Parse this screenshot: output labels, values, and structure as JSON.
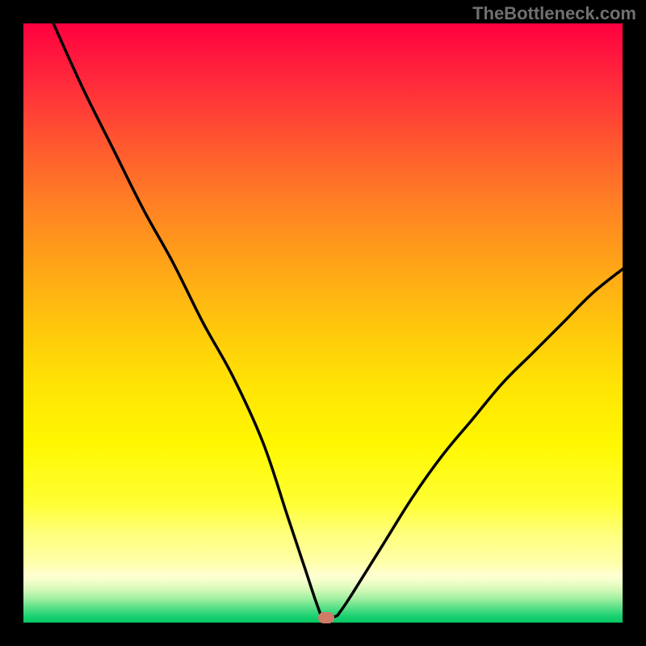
{
  "attribution": "TheBottleneck.com",
  "colors": {
    "page_bg": "#000000",
    "attribution_text": "#707070",
    "curve": "#000000",
    "marker": "#cf7b68"
  },
  "chart_data": {
    "type": "line",
    "title": "",
    "xlabel": "",
    "ylabel": "",
    "xlim": [
      0,
      100
    ],
    "ylim": [
      0,
      100
    ],
    "grid": false,
    "annotations": [
      {
        "name": "optimal-marker",
        "x": 50.5,
        "y": 0.8
      }
    ],
    "series": [
      {
        "name": "bottleneck-curve",
        "x": [
          5,
          10,
          15,
          20,
          25,
          30,
          35,
          40,
          44,
          47,
          49,
          50,
          52,
          53,
          55,
          60,
          65,
          70,
          75,
          80,
          85,
          90,
          95,
          100
        ],
        "y": [
          100,
          89,
          79,
          69,
          60,
          50,
          41,
          30,
          18,
          9,
          3,
          1,
          1,
          2,
          5,
          13,
          21,
          28,
          34,
          40,
          45,
          50,
          55,
          59
        ]
      }
    ],
    "gradient_stops": [
      {
        "pos": 0.0,
        "color": "#ff0040"
      },
      {
        "pos": 0.5,
        "color": "#ffc50d"
      },
      {
        "pos": 0.8,
        "color": "#ffff33"
      },
      {
        "pos": 0.92,
        "color": "#ffffd0"
      },
      {
        "pos": 1.0,
        "color": "#06c764"
      }
    ]
  }
}
